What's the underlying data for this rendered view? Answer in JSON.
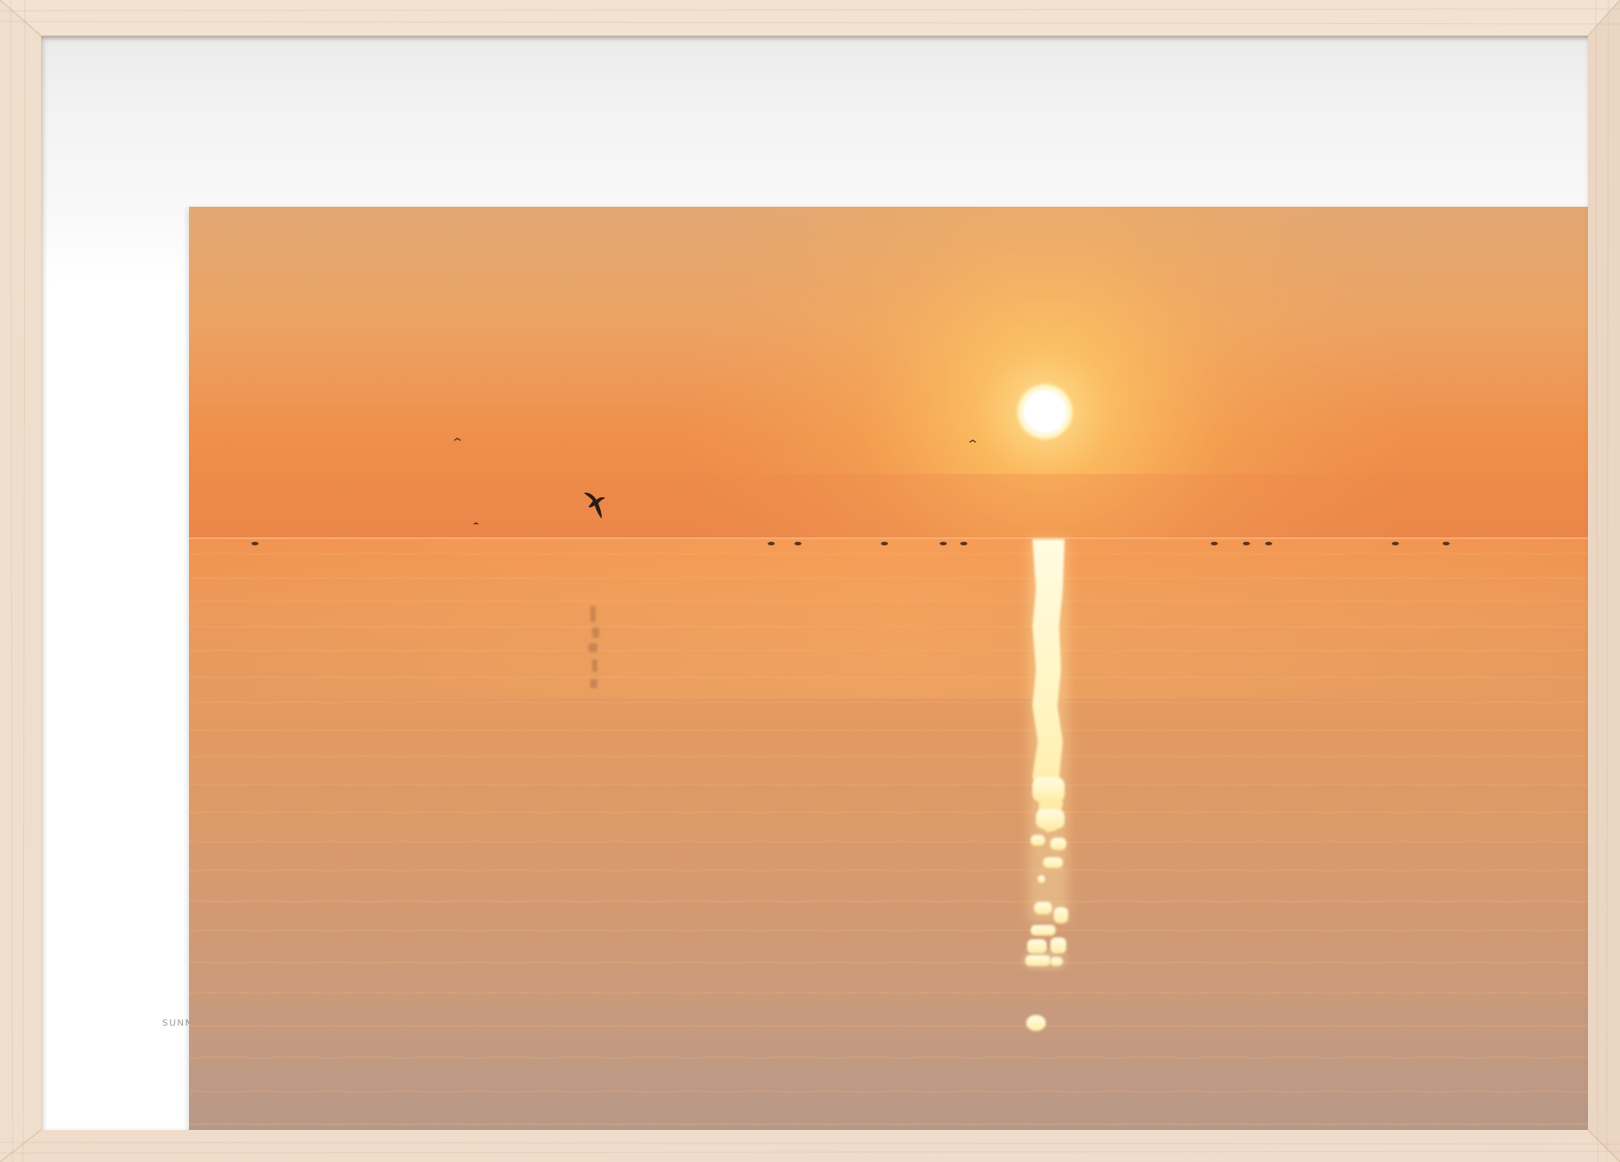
{
  "scene": {
    "kind": "framed-photo-print",
    "subject": "sunset-over-calm-sea",
    "caption_fragment": "SUNN"
  },
  "colors": {
    "frame_wood": "#efdcca",
    "mat": "#ffffff",
    "sky_top": "#e7ab6f",
    "sky_glow": "#f9bd6b",
    "horizon": "#f08a45",
    "sea": "#e79a58",
    "sea_bottom": "#b99886",
    "sun": "#ffffff",
    "sun_reflection": "#fff6c8",
    "bird": "#2a1a12"
  },
  "icons": {
    "bird": "bird-silhouette-icon",
    "sun": "sun-icon"
  }
}
